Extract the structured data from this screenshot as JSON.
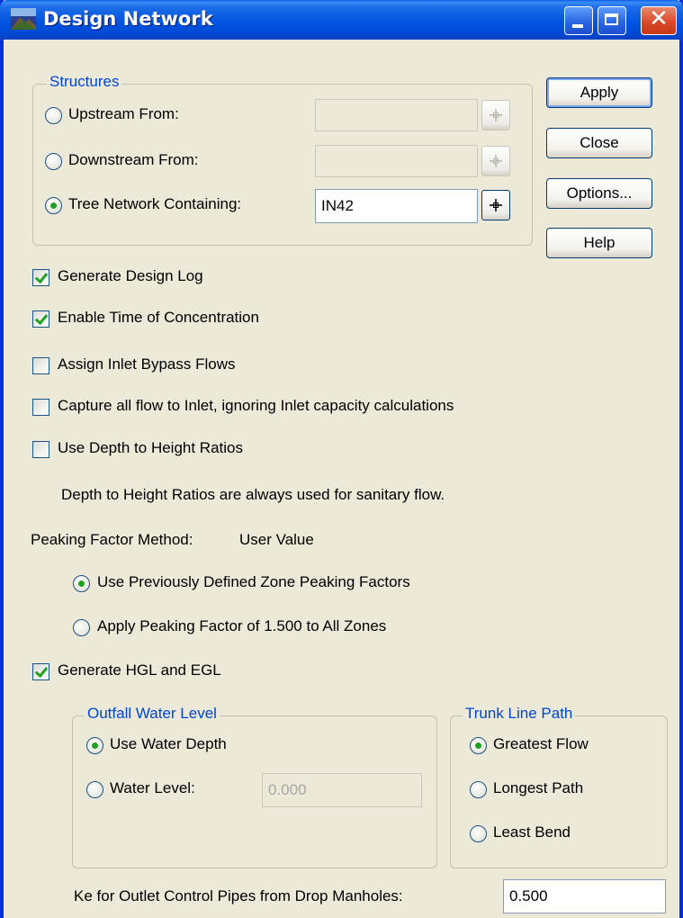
{
  "window": {
    "title": "Design Network"
  },
  "structures": {
    "legend": "Structures",
    "upstream": {
      "label": "Upstream From:",
      "value": "",
      "selected": false
    },
    "downstream": {
      "label": "Downstream From:",
      "value": "",
      "selected": false
    },
    "tree": {
      "label": "Tree Network Containing:",
      "value": "IN42",
      "selected": true
    }
  },
  "buttons": {
    "apply": "Apply",
    "close": "Close",
    "options": "Options...",
    "help": "Help"
  },
  "options": {
    "generate_design_log": {
      "label": "Generate Design Log",
      "checked": true
    },
    "enable_toc": {
      "label": "Enable Time of Concentration",
      "checked": true
    },
    "assign_inlet_bypass": {
      "label": "Assign Inlet Bypass Flows",
      "checked": false
    },
    "capture_all_flow": {
      "label": "Capture all flow to Inlet, ignoring Inlet capacity calculations",
      "checked": false
    },
    "use_depth_height": {
      "label": "Use Depth to Height Ratios",
      "checked": false
    },
    "depth_height_note": "Depth to Height Ratios are always used for sanitary flow."
  },
  "peaking": {
    "label": "Peaking Factor Method:",
    "method": "User Value",
    "use_previous": {
      "label": "Use Previously Defined Zone Peaking Factors",
      "selected": true
    },
    "apply_factor": {
      "label": "Apply Peaking Factor of 1.500 to All Zones",
      "selected": false
    }
  },
  "hgl": {
    "label": "Generate HGL and EGL",
    "checked": true
  },
  "outfall": {
    "legend": "Outfall Water Level",
    "use_water_depth": {
      "label": "Use Water Depth",
      "selected": true
    },
    "water_level": {
      "label": "Water Level:",
      "value": "0.000",
      "selected": false
    }
  },
  "trunk": {
    "legend": "Trunk Line Path",
    "greatest_flow": {
      "label": "Greatest Flow",
      "selected": true
    },
    "longest_path": {
      "label": "Longest Path",
      "selected": false
    },
    "least_bend": {
      "label": "Least Bend",
      "selected": false
    }
  },
  "ke": {
    "label": "Ke for Outlet Control Pipes from Drop Manholes:",
    "value": "0.500"
  },
  "colors": {
    "titlebar": "#0054e3",
    "legend_text": "#0046d5",
    "dialog_bg": "#ece9d8",
    "check_mark": "#21a121"
  }
}
